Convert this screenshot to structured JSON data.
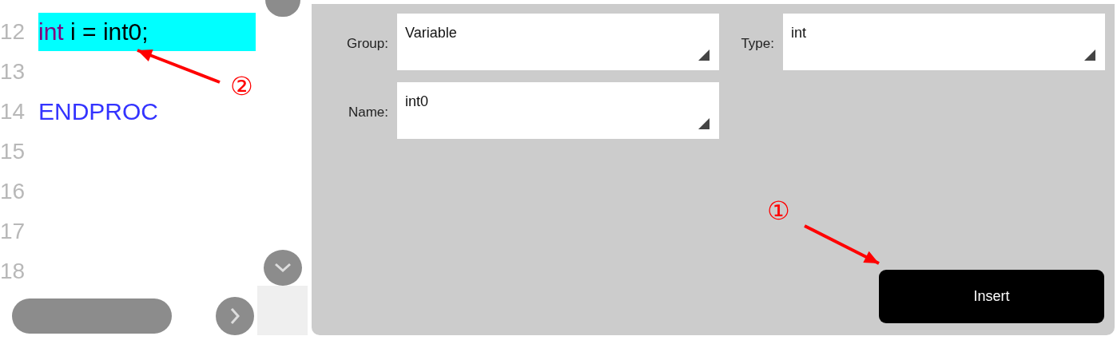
{
  "editor": {
    "lines": [
      {
        "number": "12",
        "highlighted": true,
        "tokens": [
          {
            "text": "int",
            "kind": "keyword"
          },
          {
            "text": " i = int0;",
            "kind": "plain"
          }
        ]
      },
      {
        "number": "13"
      },
      {
        "number": "14",
        "tokens": [
          {
            "text": "ENDPROC",
            "kind": "directive"
          }
        ]
      },
      {
        "number": "15"
      },
      {
        "number": "16"
      },
      {
        "number": "17"
      },
      {
        "number": "18"
      }
    ]
  },
  "form": {
    "fields": [
      {
        "label": "Group:",
        "value": "Variable"
      },
      {
        "label": "Type:",
        "value": "int"
      },
      {
        "label": "Name:",
        "value": "int0"
      }
    ],
    "button": "Insert"
  },
  "annotations": [
    {
      "label": "②"
    },
    {
      "label": "①"
    }
  ]
}
